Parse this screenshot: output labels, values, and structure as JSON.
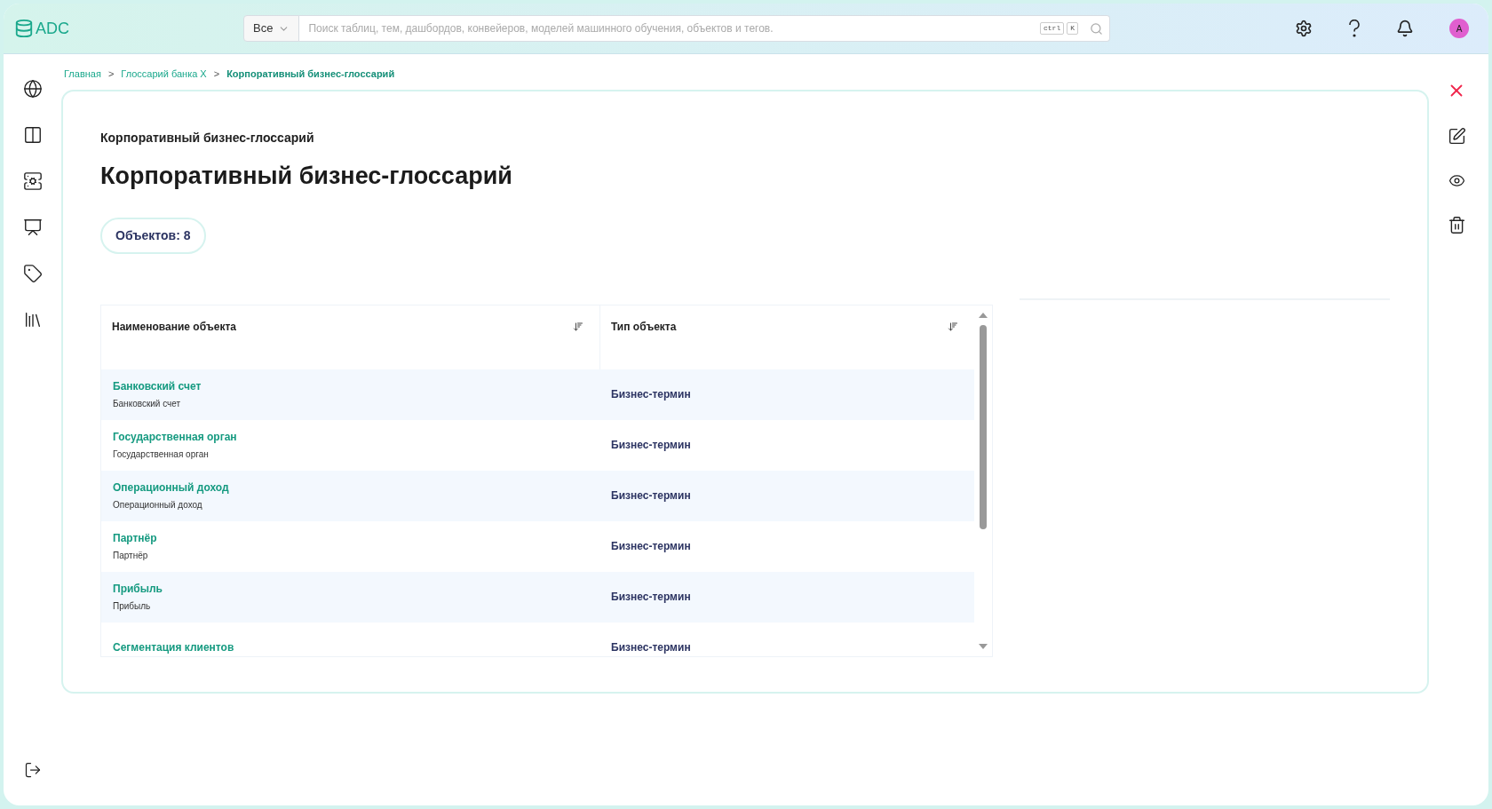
{
  "header": {
    "logo": "ADC",
    "scope": "Все",
    "search": {
      "placeholder": "Поиск таблиц, тем, дашбордов, конвейеров, моделей машинного обучения, объектов и тегов."
    },
    "shortcut": [
      "ctrl",
      "K"
    ],
    "avatar": "A"
  },
  "breadcrumbs": [
    {
      "label": "Главная",
      "current": false
    },
    {
      "label": "Глоссарий банка X",
      "current": false
    },
    {
      "label": "Корпоративный бизнес-глоссарий",
      "current": true
    }
  ],
  "breadcrumb_separator": ">",
  "page": {
    "subtitle": "Корпоративный бизнес-глоссарий",
    "title": "Корпоративный бизнес-глоссарий",
    "count_badge": "Объектов: 8"
  },
  "table": {
    "columns": [
      "Наименование объекта",
      "Тип объекта"
    ],
    "rows": [
      {
        "name": "Банковский счет",
        "description": "Банковский счет",
        "type": "Бизнес-термин"
      },
      {
        "name": "Государственная орган",
        "description": "Государственная орган",
        "type": "Бизнес-термин"
      },
      {
        "name": "Операционный доход",
        "description": "Операционный доход",
        "type": "Бизнес-термин"
      },
      {
        "name": "Партнёр",
        "description": "Партнёр",
        "type": "Бизнес-термин"
      },
      {
        "name": "Прибыль",
        "description": "Прибыль",
        "type": "Бизнес-термин"
      },
      {
        "name": "Сегментация клиентов",
        "type": "Бизнес-термин"
      }
    ]
  }
}
